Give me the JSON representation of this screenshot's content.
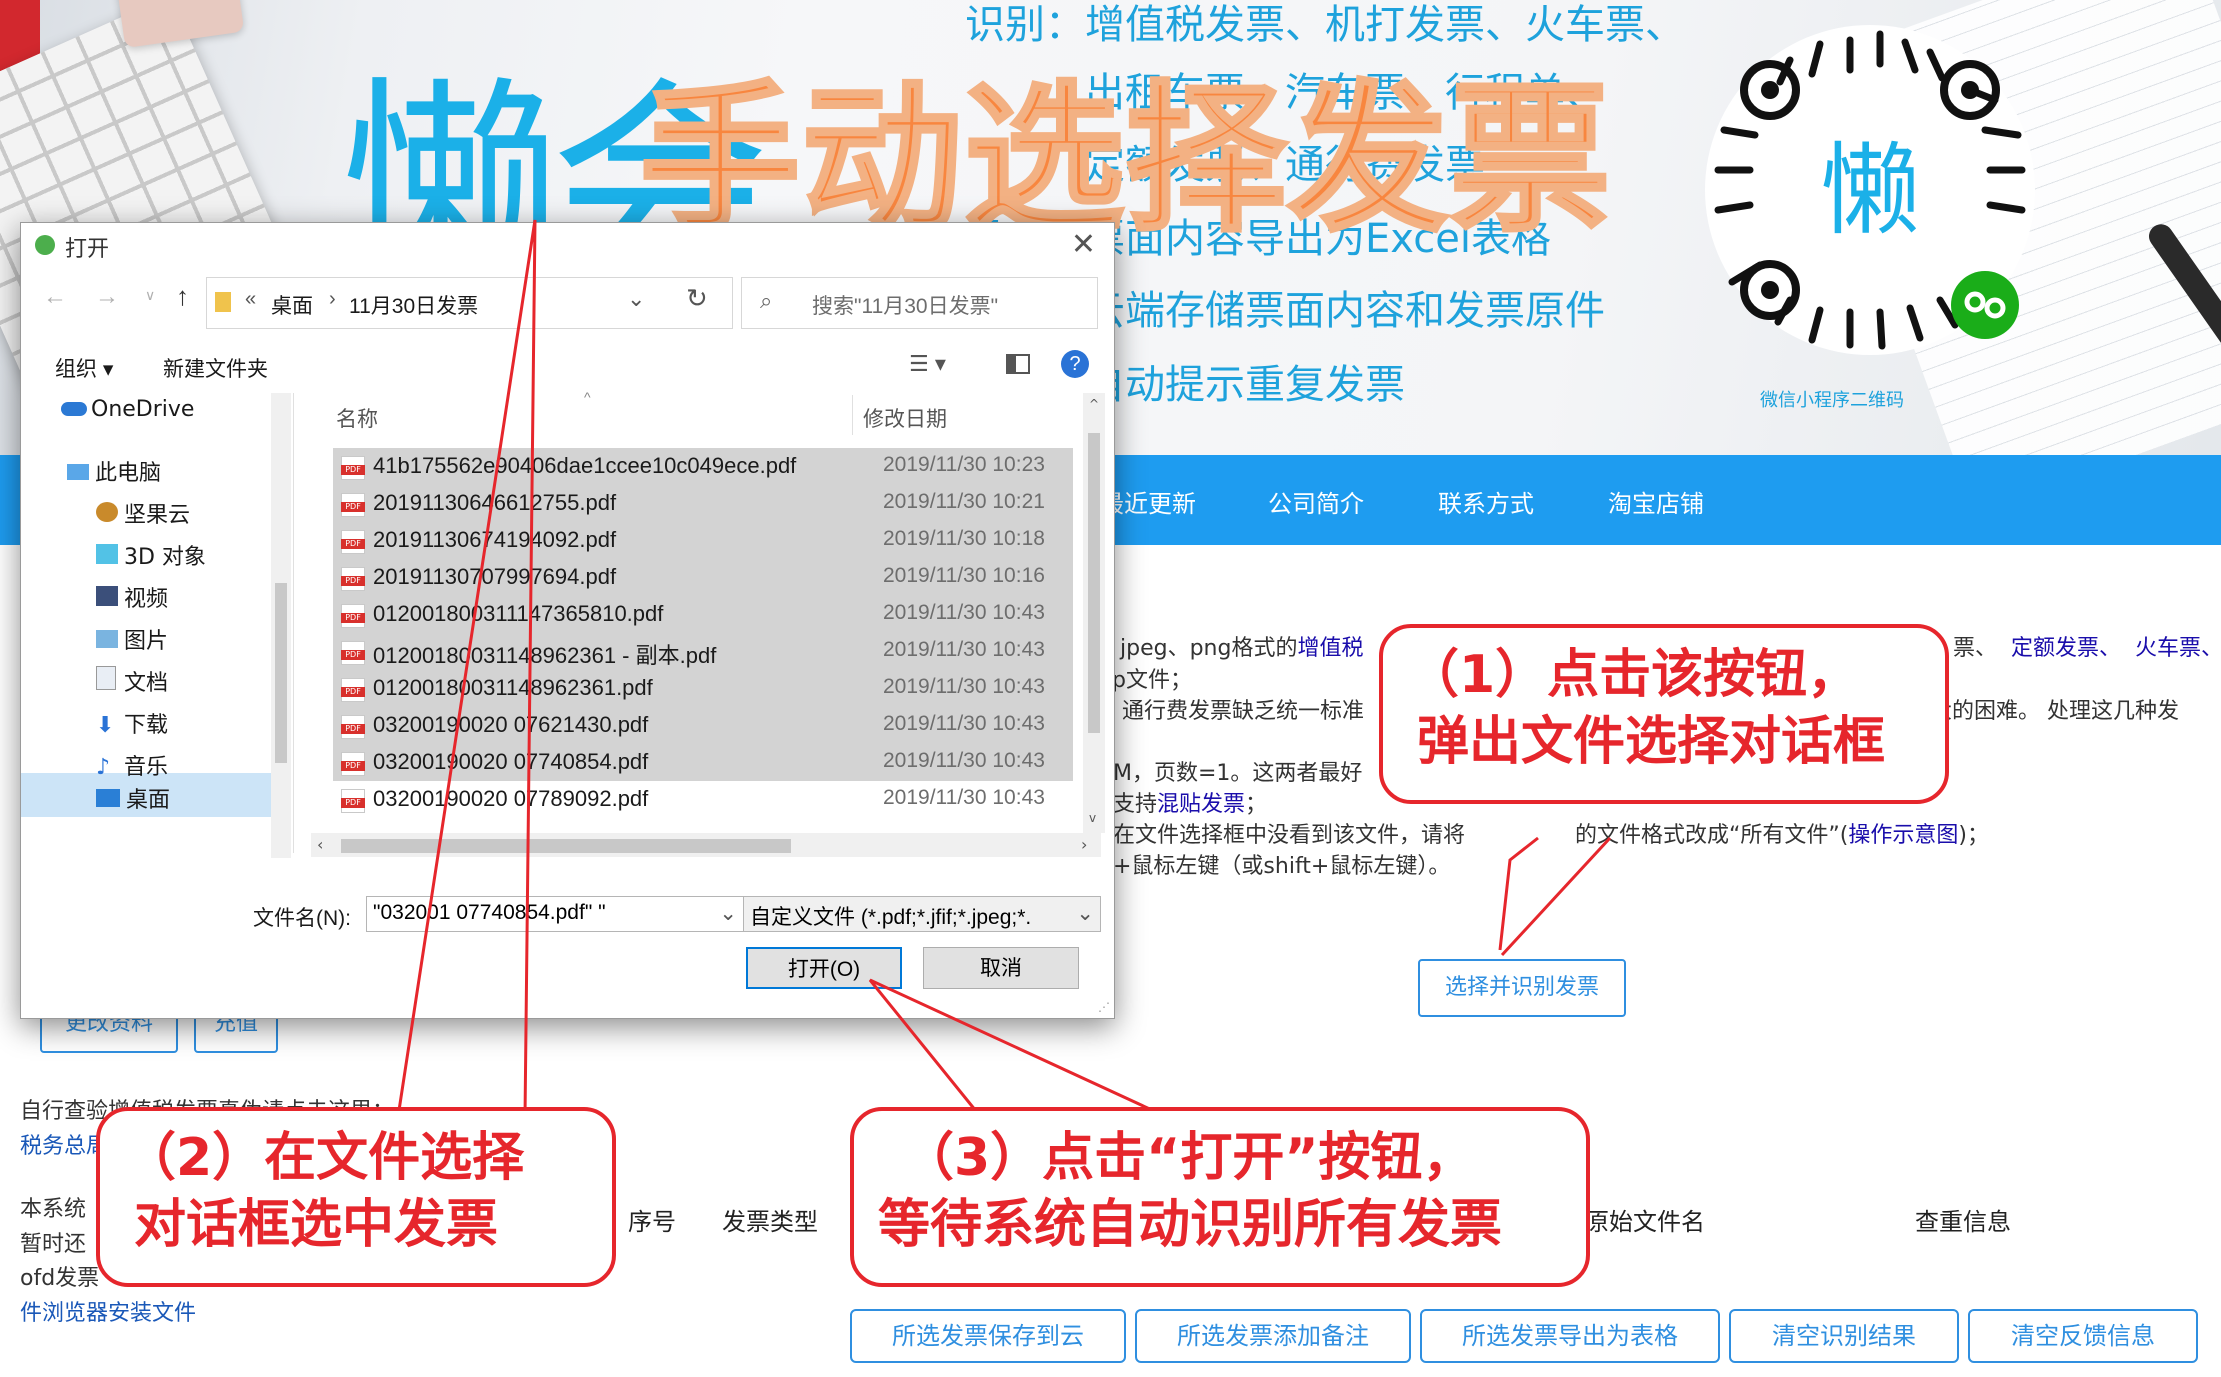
{
  "banner": {
    "logo_text": "懒会",
    "title_overlay": "手动选择发票",
    "features": [
      "识别：增值税发票、机打发票、火车票、",
      "出租车票、汽车票、行程单、",
      "定额发票、通行费发票",
      "导出：票面内容导出为Excel表格",
      "云端存储票面内容和发票原件",
      "自动提示重复发票"
    ],
    "qr_label": "微信小程序二维码",
    "qr_center_text": "懒"
  },
  "nav": {
    "items": [
      "最近更新",
      "公司简介",
      "联系方式",
      "淘宝店铺"
    ]
  },
  "content": {
    "line1_prefix": "jpeg、png格式的",
    "line1_link": "增值税",
    "line1_right_items": [
      "票、",
      "定额发票、",
      "火车票、"
    ],
    "line2": "p文件；",
    "line3": "通行费发票缺乏统一标准",
    "line3_right": "大的困难。 处理这几种发",
    "line4": "M，页数=1。这两者最好",
    "line5_prefix": "支持",
    "line5_link": "混贴发票",
    "line5_suffix": "；",
    "line6_a": "在文件选择框中没看到该文件，请将",
    "line6_b": "的文件格式改成“所有文件”(",
    "line6_link": "操作示意图",
    "line6_c": ")；",
    "line7": "+鼠标左键（或shift+鼠标左键）。",
    "select_button": "选择并识别发票",
    "edit_profile": "更改资料",
    "recharge": "充值",
    "verify_text": "自行查验增值税发票真伪请点击这里：",
    "tax_link": "税务总局",
    "note1": "本系统",
    "note2": "暂时还",
    "note3": "ofd发票",
    "install_link": "件浏览器安装文件"
  },
  "dialog": {
    "title": "打开",
    "path": [
      "桌面",
      "11月30日发票"
    ],
    "search_placeholder": "搜索\"11月30日发票\"",
    "organize": "组织",
    "new_folder": "新建文件夹",
    "sidebar": [
      {
        "label": "OneDrive",
        "icon": "cloud-icon"
      },
      {
        "label": "此电脑",
        "icon": "computer-icon"
      },
      {
        "label": "坚果云",
        "icon": "nut-icon"
      },
      {
        "label": "3D 对象",
        "icon": "cube-icon"
      },
      {
        "label": "视频",
        "icon": "video-icon"
      },
      {
        "label": "图片",
        "icon": "picture-icon"
      },
      {
        "label": "文档",
        "icon": "document-icon"
      },
      {
        "label": "下载",
        "icon": "download-icon"
      },
      {
        "label": "音乐",
        "icon": "music-icon"
      },
      {
        "label": "桌面",
        "icon": "desktop-icon"
      }
    ],
    "col_name": "名称",
    "col_date": "修改日期",
    "files": [
      {
        "name": "41b175562e90406dae1ccee10c049ece.pdf",
        "date": "2019/11/30 10:23"
      },
      {
        "name": "20191130646612755.pdf",
        "date": "2019/11/30 10:21"
      },
      {
        "name": "20191130674194092.pdf",
        "date": "2019/11/30 10:18"
      },
      {
        "name": "20191130707997694.pdf",
        "date": "2019/11/30 10:16"
      },
      {
        "name": "012001800311147365810.pdf",
        "date": "2019/11/30 10:43"
      },
      {
        "name": "01200180031148962361 - 副本.pdf",
        "date": "2019/11/30 10:43"
      },
      {
        "name": "01200180031148962361.pdf",
        "date": "2019/11/30 10:43"
      },
      {
        "name": "03200190020 07621430.pdf",
        "date": "2019/11/30 10:43"
      },
      {
        "name": "03200190020 07740854.pdf",
        "date": "2019/11/30 10:43"
      },
      {
        "name": "03200190020 07789092.pdf",
        "date": "2019/11/30 10:43"
      }
    ],
    "filename_label": "文件名(N):",
    "filename_value": "\"032001       07740854.pdf\" \"",
    "filetype": "自定义文件 (*.pdf;*.jfif;*.jpeg;*.",
    "open_button": "打开(O)",
    "cancel_button": "取消"
  },
  "callouts": {
    "c1_line1": "（1）点击该按钮，",
    "c1_line2": "弹出文件选择对话框",
    "c2_line1": "（2）在文件选择",
    "c2_line2": "对话框选中发票",
    "c3_line1": "（3）点击“打开”按钮，",
    "c3_line2": "等待系统自动识别所有发票"
  },
  "table": {
    "headers": [
      "序号",
      "发票类型",
      "原始文件名",
      "查重信息"
    ]
  },
  "bottom_buttons": [
    "所选发票保存到云",
    "所选发票添加备注",
    "所选发票导出为表格",
    "清空识别结果",
    "清空反馈信息"
  ],
  "colors": {
    "accent": "#1e9cf0",
    "callout": "#e6262c",
    "title_orange": "#f8863f",
    "link": "#1a0dab"
  }
}
